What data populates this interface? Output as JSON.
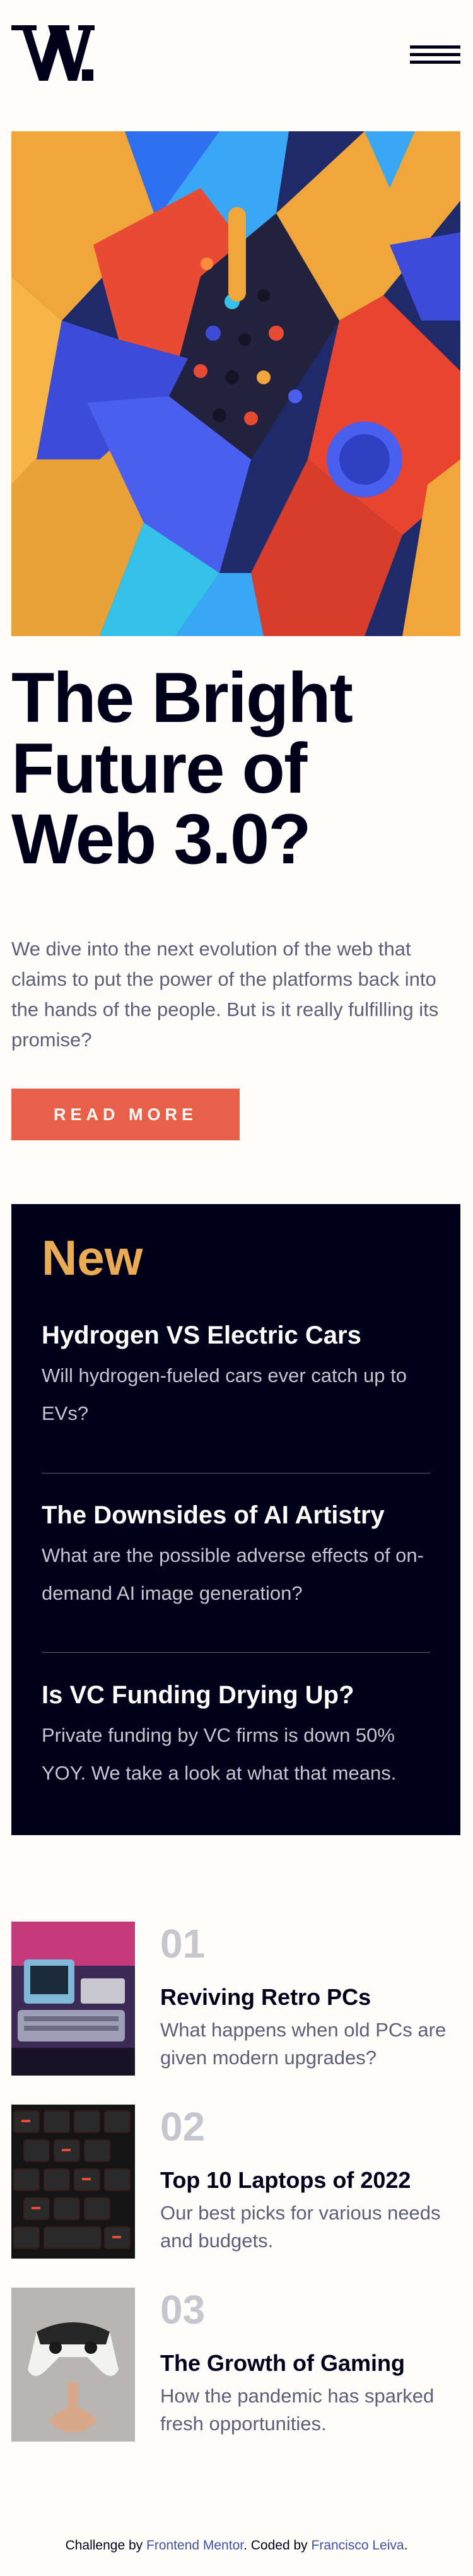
{
  "header": {
    "logo_alt": "W.",
    "menu_icon": "hamburger-menu-icon"
  },
  "hero": {
    "image_icon": "abstract-3d-shapes-image",
    "title": "The Bright Future of Web 3.0?",
    "text": "We dive into the next evolution of the web that claims to put the power of the platforms back into the hands of the people. But is it really fulfilling its promise?",
    "button_label": "READ MORE"
  },
  "new": {
    "heading": "New",
    "items": [
      {
        "title": "Hydrogen VS Electric Cars",
        "text": "Will hydrogen-fueled cars ever catch up to EVs?"
      },
      {
        "title": "The Downsides of AI Artistry",
        "text": "What are the possible adverse effects of on-demand AI image generation?"
      },
      {
        "title": "Is VC Funding Drying Up?",
        "text": "Private funding by VC firms is down 50% YOY. We take a look at what that means."
      }
    ]
  },
  "articles": [
    {
      "number": "01",
      "title": "Reviving Retro PCs",
      "text": "What happens when old PCs are given modern upgrades?",
      "image_icon": "retro-pc-image"
    },
    {
      "number": "02",
      "title": "Top 10 Laptops of 2022",
      "text": "Our best picks for various needs and budgets.",
      "image_icon": "laptop-keyboard-image"
    },
    {
      "number": "03",
      "title": "The Growth of Gaming",
      "text": "How the pandemic has sparked fresh opportunities.",
      "image_icon": "game-controller-image"
    }
  ],
  "footer": {
    "prefix": "Challenge by ",
    "challenge_link": "Frontend Mentor",
    "middle": ". Coded by ",
    "author_link": "Francisco Leiva",
    "suffix": "."
  },
  "colors": {
    "accent": "#e9604a",
    "new_heading": "#e9ab53",
    "dark": "#00001a",
    "muted": "#5d5f79",
    "link": "#3e52a3"
  }
}
